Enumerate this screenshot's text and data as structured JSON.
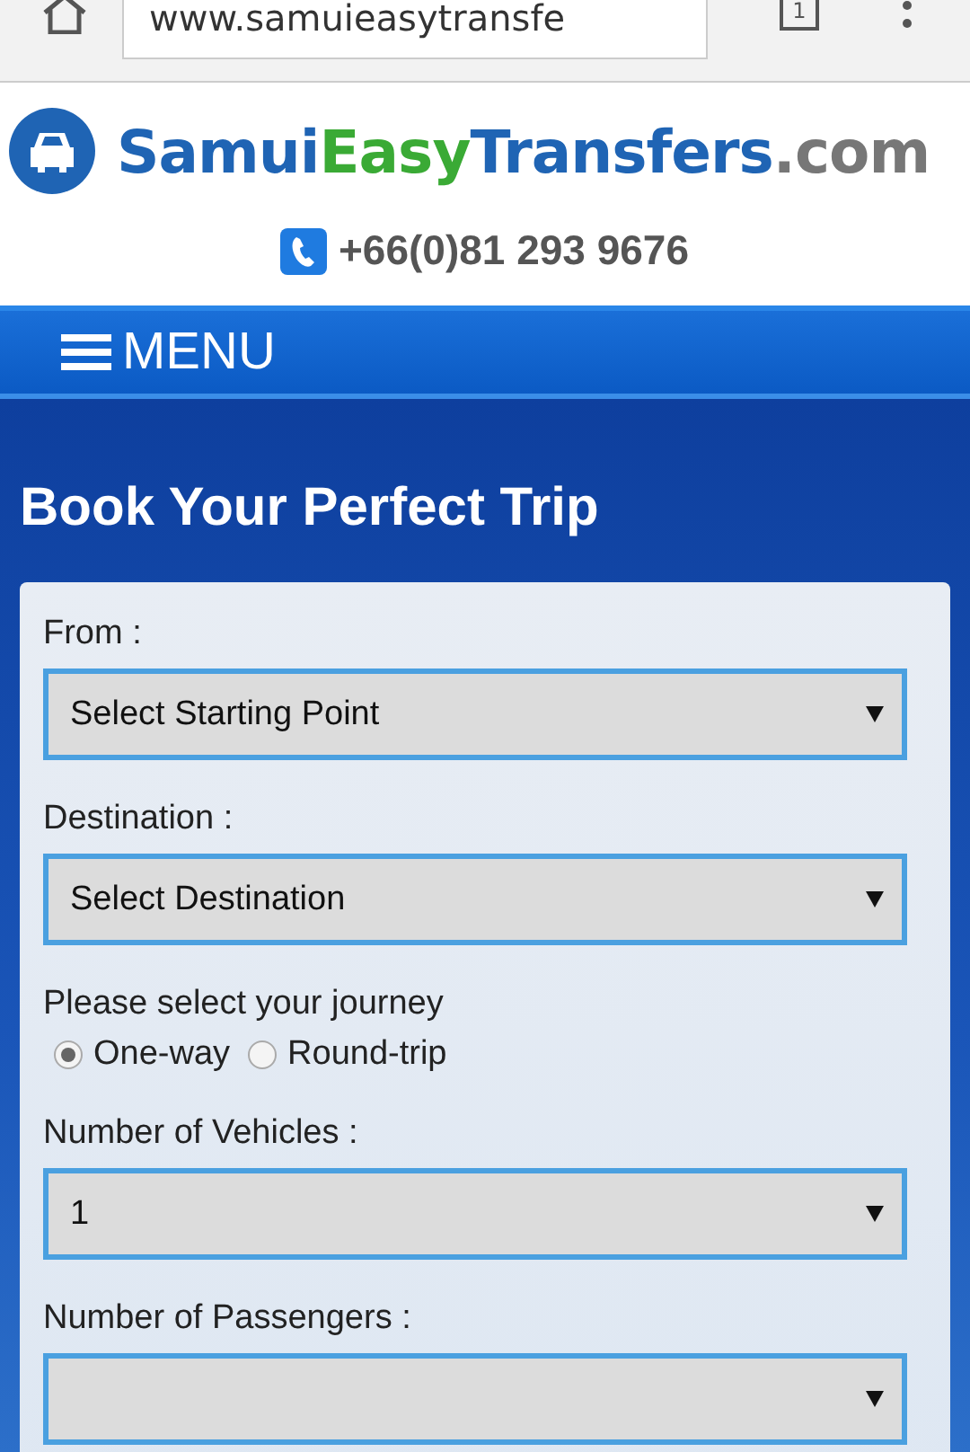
{
  "browser": {
    "url": "www.samuieasytransfe",
    "tab_count": "1"
  },
  "header": {
    "logo_parts": [
      {
        "text": "Samui",
        "color": "#1f64b4"
      },
      {
        "text": "Easy",
        "color": "#3aaa35"
      },
      {
        "text": "Transfers",
        "color": "#1f64b4"
      },
      {
        "text": ".com",
        "color": "#777777"
      }
    ],
    "phone": "+66(0)81 293 9676"
  },
  "menu": {
    "label": "MENU"
  },
  "title": "Book Your Perfect Trip",
  "form": {
    "fields": [
      {
        "kind": "select",
        "label": "From :",
        "value": "Select Starting Point"
      },
      {
        "kind": "select",
        "label": "Destination :",
        "value": "Select Destination"
      },
      {
        "kind": "radio",
        "label": "Please select your journey",
        "options": [
          {
            "label": "One-way",
            "selected": true
          },
          {
            "label": "Round-trip",
            "selected": false
          }
        ]
      },
      {
        "kind": "select",
        "label": "Number of Vehicles :",
        "value": "1"
      },
      {
        "kind": "select",
        "label": "Number of Passengers :"
      }
    ]
  }
}
